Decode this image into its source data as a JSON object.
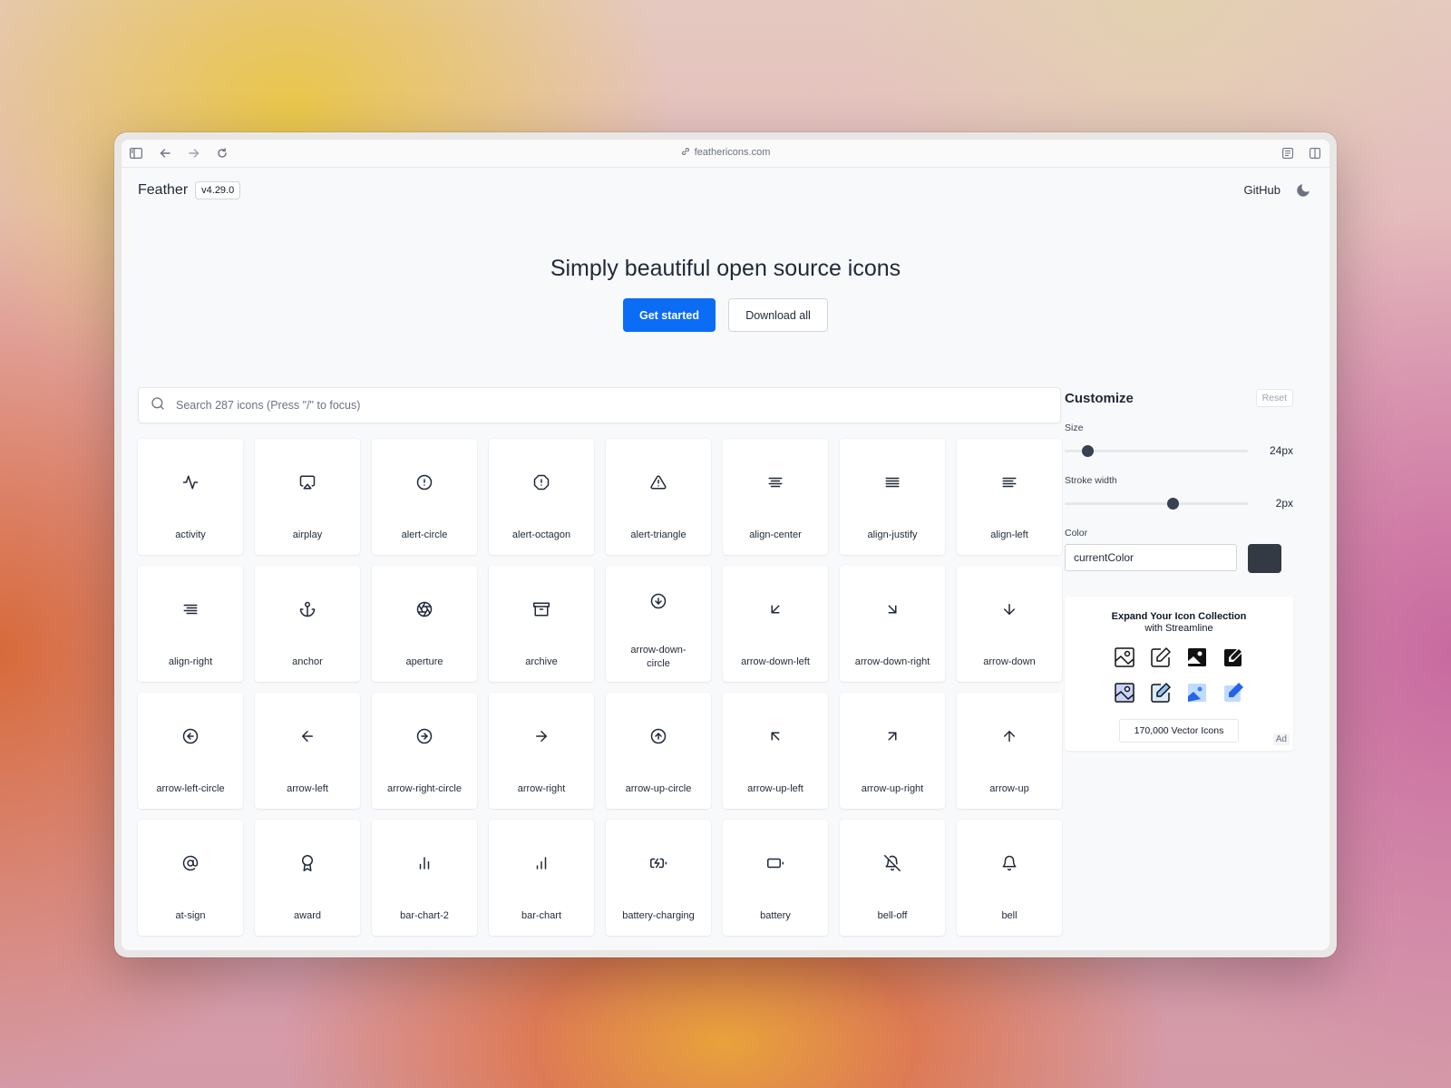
{
  "browser": {
    "url": "feathericons.com",
    "icons": [
      "sidebar-icon",
      "back-icon",
      "forward-icon",
      "reload-icon",
      "reader-icon",
      "split-view-icon"
    ]
  },
  "header": {
    "brand": "Feather",
    "version": "v4.29.0",
    "github": "GitHub",
    "theme_icon": "moon-icon"
  },
  "hero": {
    "title": "Simply beautiful open source icons",
    "primary_button": "Get started",
    "secondary_button": "Download all"
  },
  "search": {
    "placeholder": "Search 287 icons (Press \"/\" to focus)"
  },
  "icons": [
    {
      "name": "activity"
    },
    {
      "name": "airplay"
    },
    {
      "name": "alert-circle"
    },
    {
      "name": "alert-octagon"
    },
    {
      "name": "alert-triangle"
    },
    {
      "name": "align-center"
    },
    {
      "name": "align-justify"
    },
    {
      "name": "align-left"
    },
    {
      "name": "align-right"
    },
    {
      "name": "anchor"
    },
    {
      "name": "aperture"
    },
    {
      "name": "archive"
    },
    {
      "name": "arrow-down-circle",
      "label": "arrow-down-\ncircle"
    },
    {
      "name": "arrow-down-left"
    },
    {
      "name": "arrow-down-right"
    },
    {
      "name": "arrow-down"
    },
    {
      "name": "arrow-left-circle"
    },
    {
      "name": "arrow-left"
    },
    {
      "name": "arrow-right-circle"
    },
    {
      "name": "arrow-right"
    },
    {
      "name": "arrow-up-circle"
    },
    {
      "name": "arrow-up-left"
    },
    {
      "name": "arrow-up-right"
    },
    {
      "name": "arrow-up"
    },
    {
      "name": "at-sign"
    },
    {
      "name": "award"
    },
    {
      "name": "bar-chart-2"
    },
    {
      "name": "bar-chart"
    },
    {
      "name": "battery-charging"
    },
    {
      "name": "battery"
    },
    {
      "name": "bell-off"
    },
    {
      "name": "bell"
    }
  ],
  "customize": {
    "title": "Customize",
    "reset": "Reset",
    "size_label": "Size",
    "size_value": "24px",
    "size_fraction": 0.1,
    "stroke_label": "Stroke width",
    "stroke_value": "2px",
    "stroke_fraction": 0.6,
    "color_label": "Color",
    "color_value": "currentColor",
    "swatch_color": "#333a43"
  },
  "ad": {
    "title": "Expand Your Icon Collection",
    "subtitle": "with Streamline",
    "button": "170,000 Vector Icons",
    "tag": "Ad"
  },
  "colors": {
    "accent": "#0b6cf6",
    "text": "#1f2937"
  }
}
